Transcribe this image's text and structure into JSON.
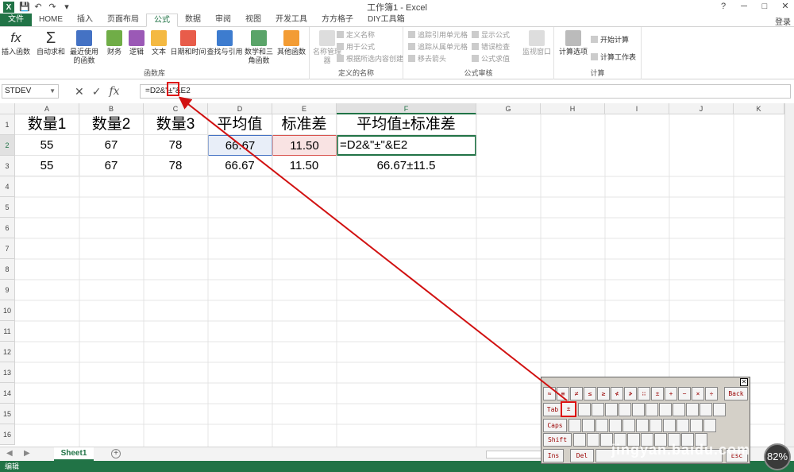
{
  "window": {
    "title": "工作簿1 - Excel",
    "login": "登录",
    "min": "─",
    "help": "?",
    "restore": "□",
    "close": "✕"
  },
  "quick_access": {
    "save": "💾",
    "undo": "↶",
    "redo": "↷",
    "more": "▾"
  },
  "tabs": [
    "文件",
    "HOME",
    "插入",
    "页面布局",
    "公式",
    "数据",
    "审阅",
    "视图",
    "开发工具",
    "方方格子",
    "DIY工具箱"
  ],
  "active_tab": "公式",
  "ribbon": {
    "function_library": {
      "label": "函数库",
      "buttons": [
        "插入函数",
        "自动求和",
        "最近使用的函数",
        "财务",
        "逻辑",
        "文本",
        "日期和时间",
        "查找与引用",
        "数学和三角函数",
        "其他函数"
      ]
    },
    "defined_names": {
      "label": "定义的名称",
      "name_manager": "名称管理器",
      "items": [
        "定义名称",
        "用于公式",
        "根据所选内容创建"
      ]
    },
    "formula_audit": {
      "label": "公式审核",
      "items": [
        "追踪引用单元格",
        "追踪从属单元格",
        "移去箭头",
        "显示公式",
        "错误检查",
        "公式求值"
      ],
      "watch": "监视窗口"
    },
    "calculation": {
      "label": "计算",
      "options": "计算选项",
      "items": [
        "开始计算",
        "计算工作表"
      ]
    }
  },
  "formula_bar": {
    "name_box": "STDEV",
    "cancel": "✕",
    "enter": "✓",
    "fx": "fx",
    "content": "=D2&\"±\"&E2"
  },
  "columns": [
    "A",
    "B",
    "C",
    "D",
    "E",
    "F",
    "G",
    "H",
    "I",
    "J",
    "K"
  ],
  "rows": [
    "1",
    "2",
    "3",
    "4",
    "5",
    "6",
    "7",
    "8",
    "9",
    "10",
    "11",
    "12",
    "13",
    "14",
    "15",
    "16"
  ],
  "cells": {
    "row1": [
      "数量1",
      "数量2",
      "数量3",
      "平均值",
      "标准差",
      "平均值±标准差"
    ],
    "row2": [
      "55",
      "67",
      "78",
      "66.67",
      "11.50",
      "=D2&\"±\"&E2"
    ],
    "row3": [
      "55",
      "67",
      "78",
      "66.67",
      "11.50",
      "66.67±11.5"
    ]
  },
  "sheet_tab": "Sheet1",
  "add_sheet": "+",
  "status": "编辑",
  "osk": {
    "close": "✕",
    "row1": [
      "≈",
      "≡",
      "≠",
      "≤",
      "≥",
      "≮",
      "≯",
      "∷",
      "±",
      "+",
      "−",
      "×",
      "÷",
      "Back"
    ],
    "tab": "Tab",
    "highlighted_key": "±",
    "caps": "Caps",
    "shift": "Shift",
    "ins": "Ins",
    "del": "Del",
    "esc": "Esc"
  },
  "badge": "82%",
  "watermark": "jingyan.baidu.com",
  "colors": {
    "accent": "#217346",
    "annotation": "#d11111"
  }
}
